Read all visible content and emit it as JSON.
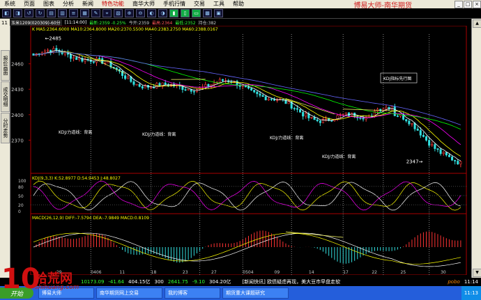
{
  "menu": {
    "items": [
      "系统",
      "页面",
      "图表",
      "分析",
      "新闻",
      "特色功能",
      "南华大师",
      "手机行情",
      "交易",
      "工具",
      "帮助"
    ],
    "active_index": 5,
    "brand": "博易大师-南华期货",
    "window_buttons": [
      "_",
      "□",
      "×"
    ]
  },
  "toolbar": {
    "buttons": 20,
    "selected": [
      15,
      16,
      17
    ]
  },
  "sidebar": {
    "collapse": "11",
    "tabs": [
      "报价画面",
      "成交明细",
      "分时走势"
    ]
  },
  "info": {
    "contract": "玉米1209(020309)-60分",
    "time": "[11:14:00]",
    "last": "最新:2359 -0.25%",
    "open": "今开:2359",
    "high": "最高:2364",
    "low": "最低:2352",
    "volume": "持仓:382"
  },
  "main_panel": {
    "ma_legend": "K MA5:2364.6000 MA10:2364.8000 MA20:2370.5500 MA40:2383.2750 MA60:2388.0167",
    "y_ticks": [
      "2460",
      "2430",
      "2400",
      "2370"
    ],
    "high_label": "2485",
    "low_label": "2347",
    "annotations": [
      "KDJ/力道线：背离",
      "KDJ/力道线：背离",
      "KDJ/力道线：背离",
      "KDJ/力道线：背离"
    ],
    "callout": "KDJ指标先行图"
  },
  "kdj_panel": {
    "legend": "KDJ(9,3,3) K:52.8977 D:54.9453 J:48.8027",
    "y_ticks": [
      "100",
      "80",
      "50",
      "20",
      "0"
    ]
  },
  "macd_panel": {
    "legend": "MACD(26,12,9) DIFF:-7.5794 DEA:-7.9849 MACD:0.8109"
  },
  "x_axis": [
    "29",
    "0406",
    "11",
    "18",
    "23",
    "27",
    "0504",
    "09",
    "14",
    "17",
    "22",
    "25",
    "30"
  ],
  "bottom": {
    "v1": "10173.09",
    "v2": "-41.64",
    "v3": "404.15亿",
    "v4": "300",
    "v5": "2641.75",
    "v6": "-9.10",
    "v7": "304.20亿",
    "news": "[新闻快讯] 欧债疑虑再现，美大豆市早盘走软",
    "brand": "pobo",
    "clock": "11:14"
  },
  "taskbar": {
    "start": "开始",
    "tasks": [
      "博易大师",
      "南华期货网上交易",
      "我的博客",
      "期货重大课题研究"
    ],
    "clock": "11:13"
  },
  "watermark": {
    "num": "10",
    "text": "拾荒网",
    "sub": "shihuang.com"
  },
  "colors": {
    "candle_up": "#ff3b3b",
    "candle_down": "#33e0e0",
    "ma5": "#ffffff",
    "ma10": "#ffff00",
    "ma20": "#ff00ff",
    "ma40": "#00ff00",
    "ma60": "#6666ff",
    "divergence": "#ffff66",
    "panel_border": "#aa0000"
  }
}
